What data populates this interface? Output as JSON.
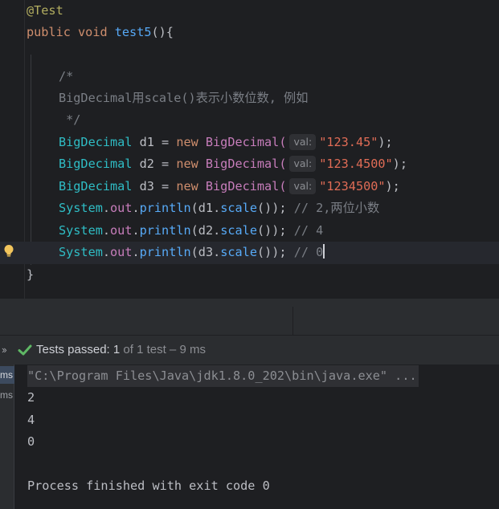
{
  "editor": {
    "annotation": "@Test",
    "method_kw_public": "public",
    "method_kw_void": "void",
    "method_name": "test5",
    "method_open": "(){",
    "comment_open": "/*",
    "comment_body": "BigDecimal用scale()表示小数位数, 例如",
    "comment_close": " */",
    "hint_label": "val:",
    "lines": [
      {
        "type": "BigDecimal",
        "var": " d1 = ",
        "kw": "new",
        "ctor": " BigDecimal(",
        "arg": "\"123.45\"",
        "end": ");"
      },
      {
        "type": "BigDecimal",
        "var": " d2 = ",
        "kw": "new",
        "ctor": " BigDecimal(",
        "arg": "\"123.4500\"",
        "end": ");"
      },
      {
        "type": "BigDecimal",
        "var": " d3 = ",
        "kw": "new",
        "ctor": " BigDecimal(",
        "arg": "\"1234500\"",
        "end": ");"
      }
    ],
    "prints": [
      {
        "cls": "System",
        "dot1": ".",
        "field": "out",
        "dot2": ".",
        "method": "println",
        "open": "(",
        "recv": "d1",
        "dot3": ".",
        "call": "scale",
        "rest": "()); ",
        "comment": "// 2,两位小数"
      },
      {
        "cls": "System",
        "dot1": ".",
        "field": "out",
        "dot2": ".",
        "method": "println",
        "open": "(",
        "recv": "d2",
        "dot3": ".",
        "call": "scale",
        "rest": "()); ",
        "comment": "// 4"
      },
      {
        "cls": "System",
        "dot1": ".",
        "field": "out",
        "dot2": ".",
        "method": "println",
        "open": "(",
        "recv": "d3",
        "dot3": ".",
        "call": "scale",
        "rest": "()); ",
        "comment": "// 0"
      }
    ],
    "closing_brace": "}"
  },
  "test_status": {
    "label": "Tests passed: ",
    "passed": "1",
    "rest": " of 1 test – 9 ms",
    "expand_icon": "double-chevron-right-icon",
    "status_icon": "check-icon",
    "status_color": "#5fb865"
  },
  "left_strip": {
    "items": [
      "ms",
      "ms"
    ]
  },
  "console": {
    "command": "\"C:\\Program Files\\Java\\jdk1.8.0_202\\bin\\java.exe\" ...",
    "output": [
      "2",
      "4",
      "0"
    ],
    "exit_message": "Process finished with exit code 0"
  },
  "colors": {
    "editor_bg": "#1e1f22",
    "panel_bg": "#2b2d30",
    "keyword": "#cf8e6d",
    "string": "#e06c56",
    "class": "#2fbdc5",
    "comment": "#7a7e85",
    "method": "#57aaf7"
  }
}
